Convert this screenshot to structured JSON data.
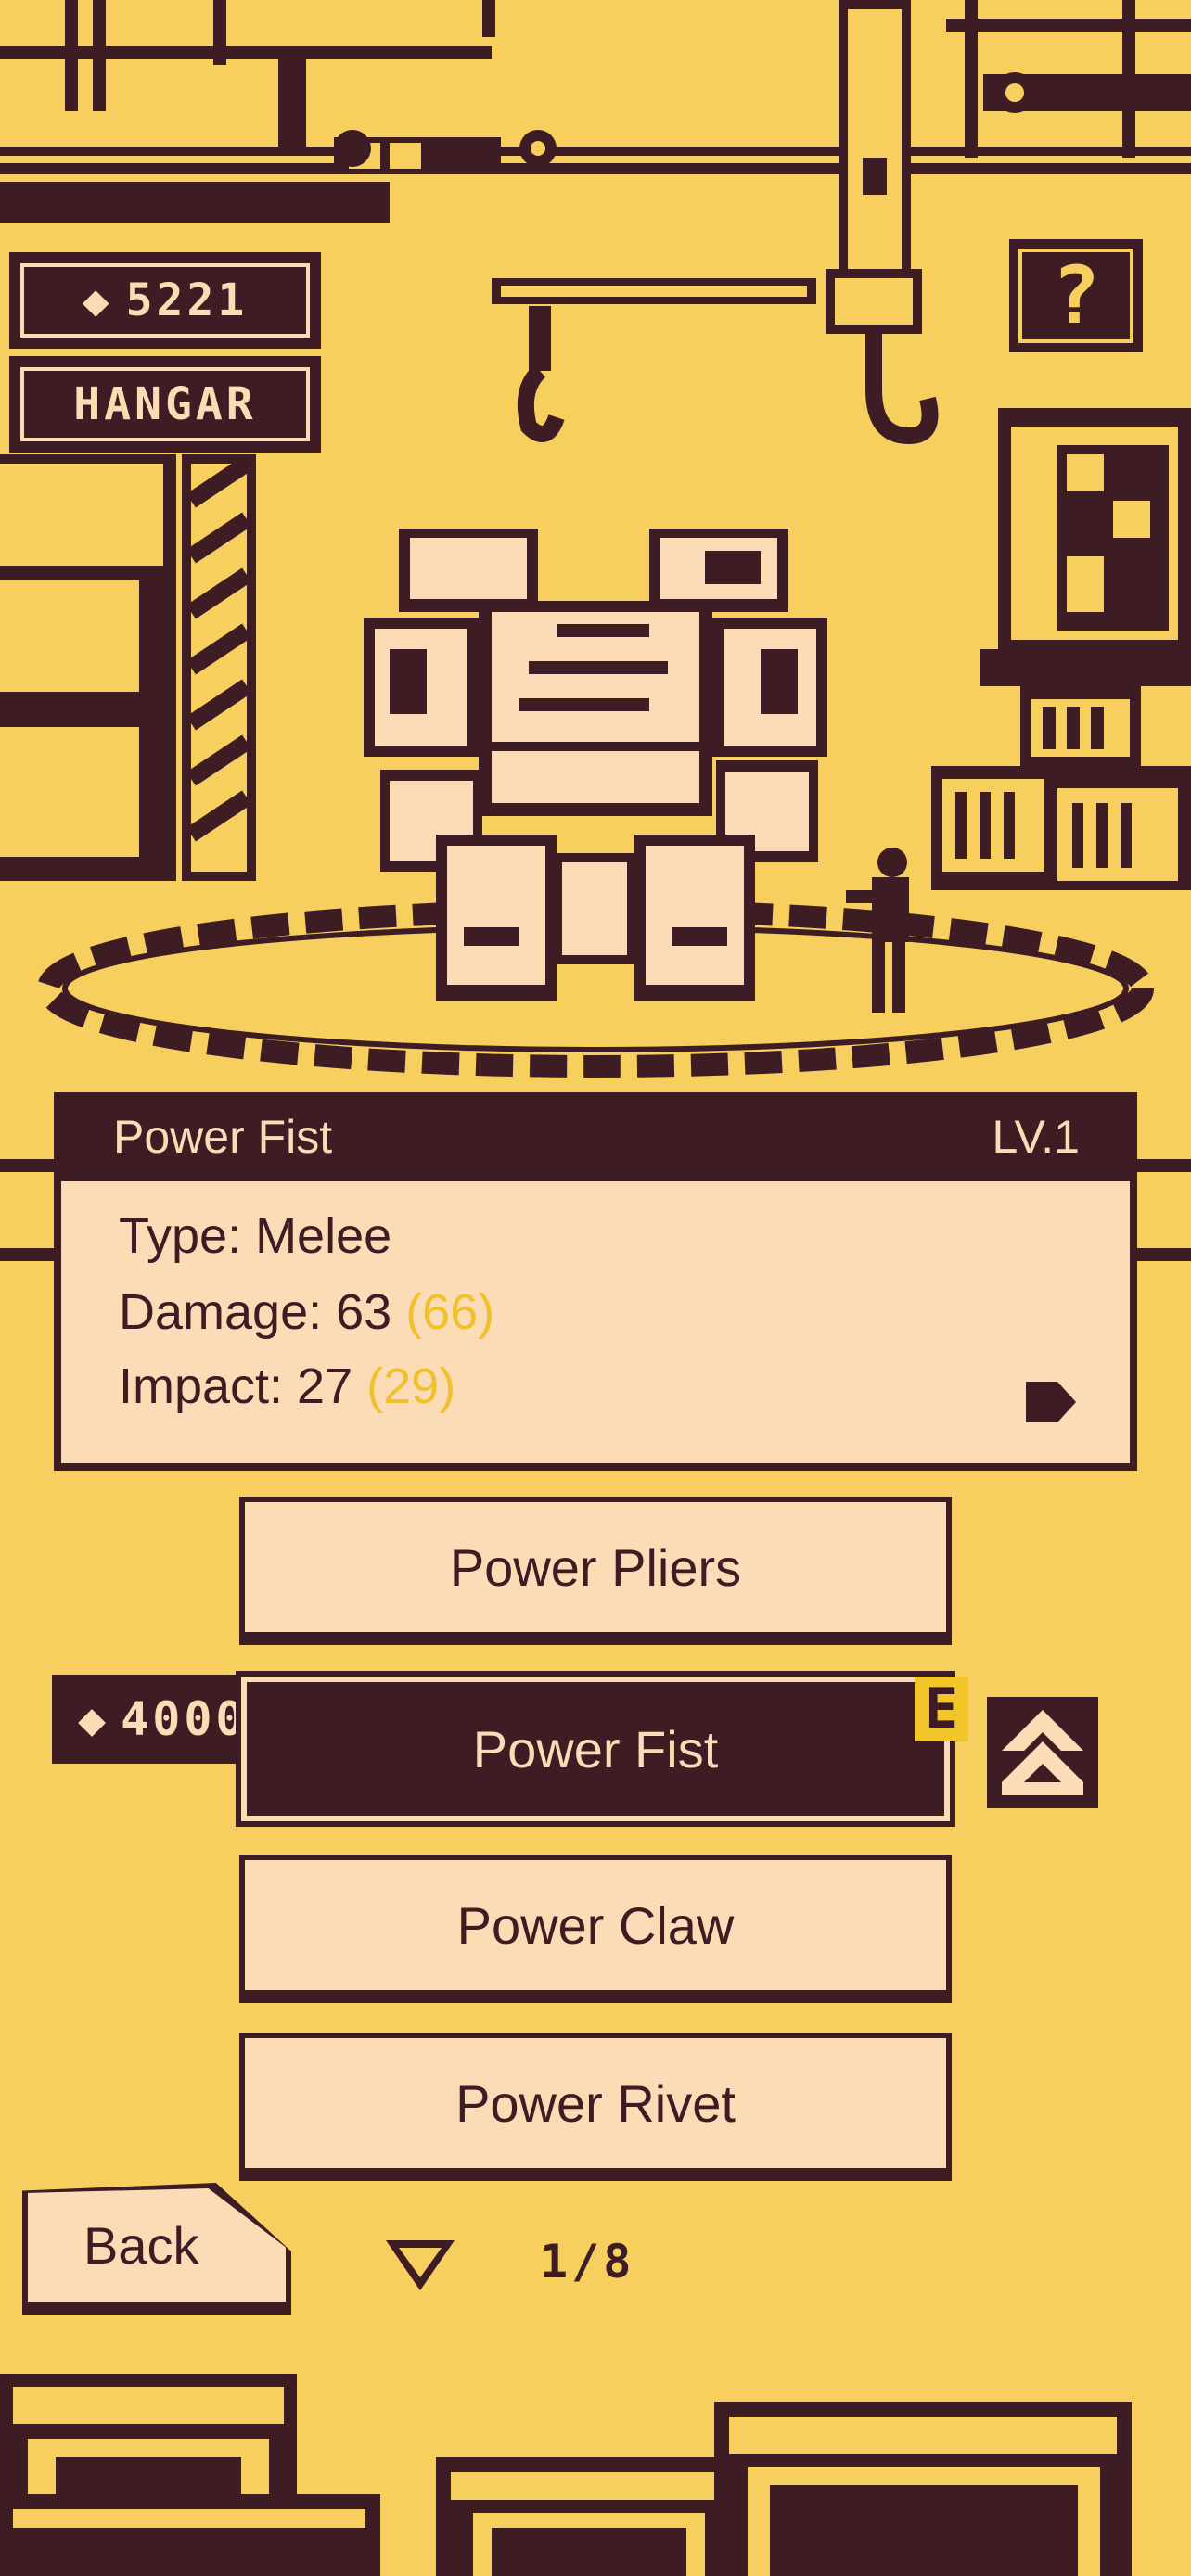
{
  "hud": {
    "coins": "5221",
    "location": "HANGAR",
    "help": "?"
  },
  "info": {
    "name": "Power Fist",
    "level": "LV.1",
    "type_label": "Type: Melee",
    "damage_label": "Damage: 63",
    "damage_next": "(66)",
    "impact_label": "Impact: 27",
    "impact_next": "(29)"
  },
  "list": {
    "items": [
      "Power Pliers",
      "Power Fist",
      "Power Claw",
      "Power Rivet"
    ],
    "selected_index": 1,
    "selected_price": "4000",
    "equipped_badge": "E"
  },
  "nav": {
    "back": "Back",
    "page": "1/8"
  },
  "colors": {
    "background": "#f6cf5f",
    "dark": "#3e1c23",
    "panel": "#fcdcb7",
    "upgrade_preview": "#f0c12c"
  }
}
